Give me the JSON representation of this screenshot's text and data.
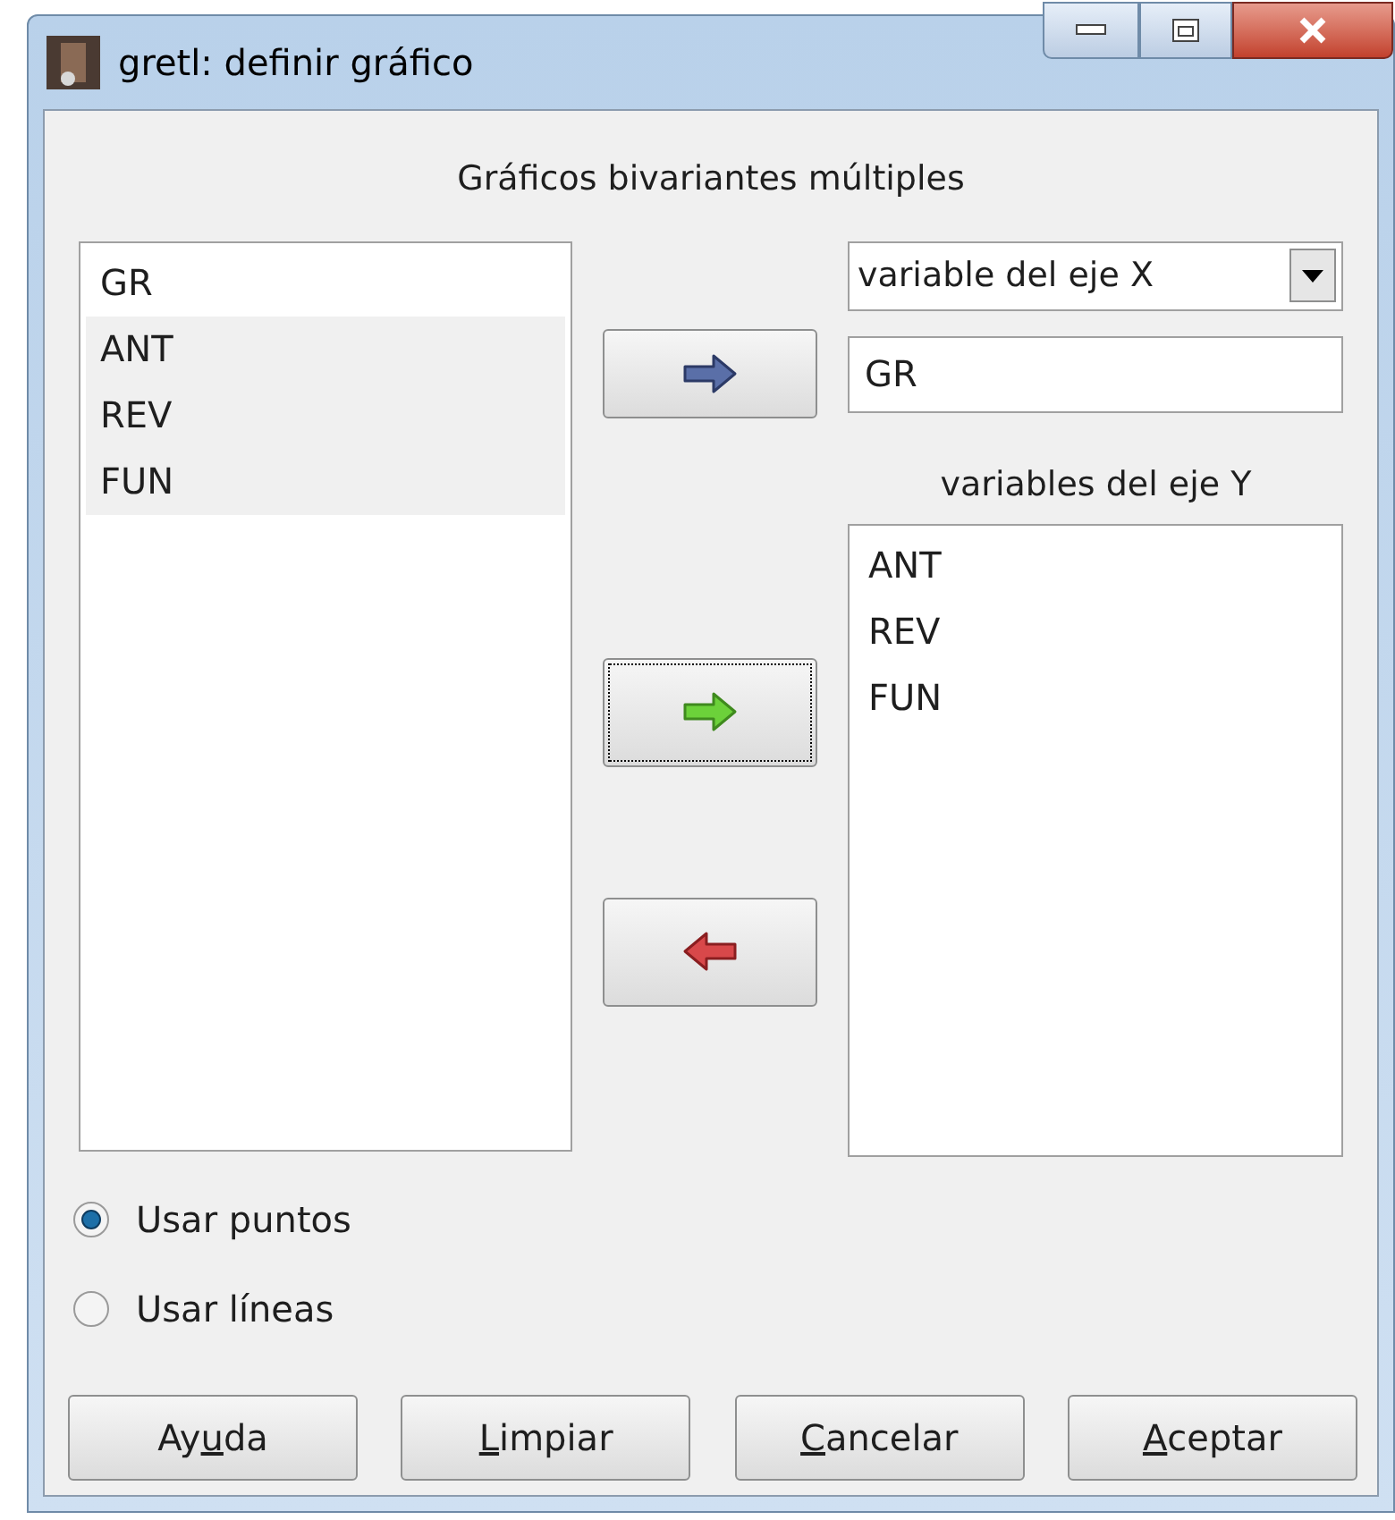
{
  "window": {
    "title": "gretl: definir gráfico"
  },
  "heading": "Gráficos bivariantes múltiples",
  "source_list": [
    {
      "label": "GR",
      "selected": false
    },
    {
      "label": "ANT",
      "selected": true
    },
    {
      "label": "REV",
      "selected": true
    },
    {
      "label": "FUN",
      "selected": true
    }
  ],
  "arrow_buttons": [
    {
      "kind": "blue-right",
      "focused": false
    },
    {
      "kind": "green-right",
      "focused": true
    },
    {
      "kind": "red-left",
      "focused": false
    }
  ],
  "x_axis_dropdown": {
    "value": "variable del eje X"
  },
  "x_variable_field": {
    "value": "GR"
  },
  "y_label": "variables del eje Y",
  "y_list": [
    {
      "label": "ANT"
    },
    {
      "label": "REV"
    },
    {
      "label": "FUN"
    }
  ],
  "radios": [
    {
      "label": "Usar puntos",
      "selected": true
    },
    {
      "label": "Usar líneas",
      "selected": false
    }
  ],
  "buttons": [
    {
      "before": "Ay",
      "key": "u",
      "after": "da"
    },
    {
      "key": "L",
      "after": "impiar"
    },
    {
      "key": "C",
      "after": "ancelar"
    },
    {
      "key": "A",
      "after": "ceptar"
    }
  ]
}
